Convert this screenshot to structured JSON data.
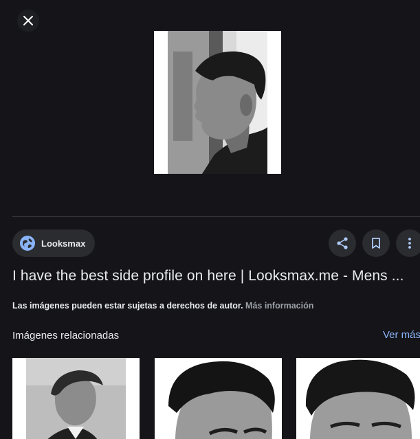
{
  "viewer": {
    "close_icon": "close-icon",
    "main_image_icon": "profile-photo"
  },
  "source": {
    "icon": "globe-icon",
    "name": "Looksmax"
  },
  "actions": {
    "share_icon": "share-icon",
    "save_icon": "bookmark-icon",
    "more_icon": "more-vert-icon"
  },
  "title": "I have the best side profile on here | Looksmax.me - Mens ...",
  "copyright": {
    "note": "Las imágenes pueden estar sujetas a derechos de autor.",
    "more_link": "Más información"
  },
  "related": {
    "heading": "Imágenes relacionadas",
    "see_more": "Ver más"
  },
  "colors": {
    "background": "#151519",
    "chip": "#2b2c30",
    "link": "#8ab4f8",
    "globe": "#8ab4f8"
  }
}
